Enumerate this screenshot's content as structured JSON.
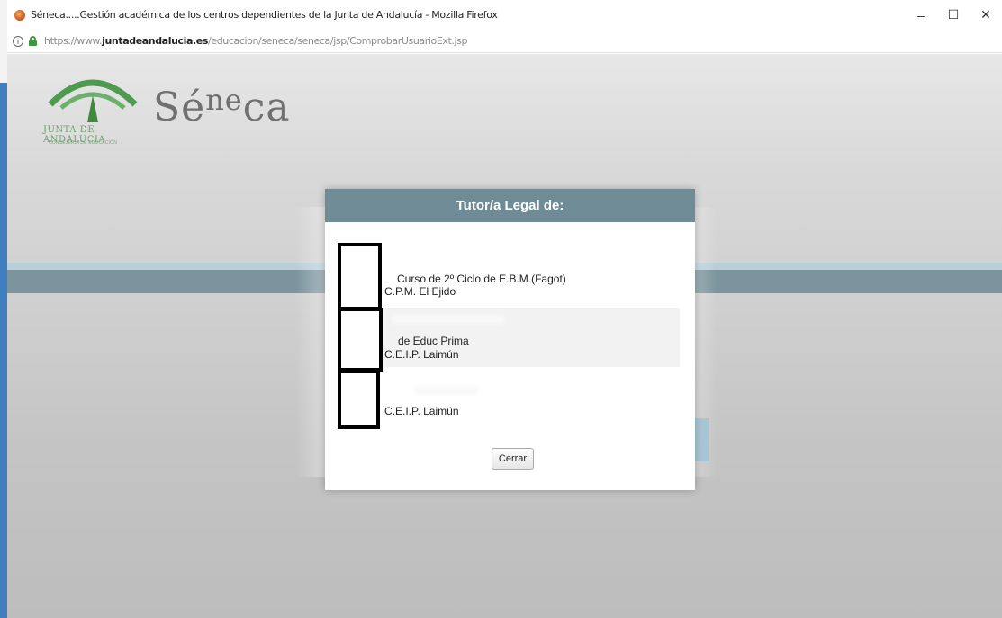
{
  "window": {
    "title": "Séneca.....Gestión académica de los centros dependientes de la Junta de Andalucía - Mozilla Firefox",
    "controls": {
      "minimize": "–",
      "maximize": "☐",
      "close": "✕"
    }
  },
  "address_bar": {
    "url_prefix": "https://www.",
    "url_domain": "juntadeandalucia.es",
    "url_path": "/educacion/seneca/seneca/jsp/ComprobarUsuarioExt.jsp"
  },
  "branding": {
    "junta_text": "JUNTA DE ANDALUCIA",
    "consejeria_text": "CONSEJERÍA DE EDUCACIÓN",
    "app_name_a": "Sé",
    "app_name_b": "ne",
    "app_name_c": "ca"
  },
  "modal": {
    "title": "Tutor/a Legal de:",
    "students": [
      {
        "course": "Curso de 2º Ciclo de E.B.M.(Fagot)",
        "school": "C.P.M. El Ejido"
      },
      {
        "course": "de Educ Prima",
        "school": "C.E.I.P. Laimún"
      },
      {
        "course": "",
        "school": "C.E.I.P. Laimún"
      }
    ],
    "close_label": "Cerrar"
  }
}
